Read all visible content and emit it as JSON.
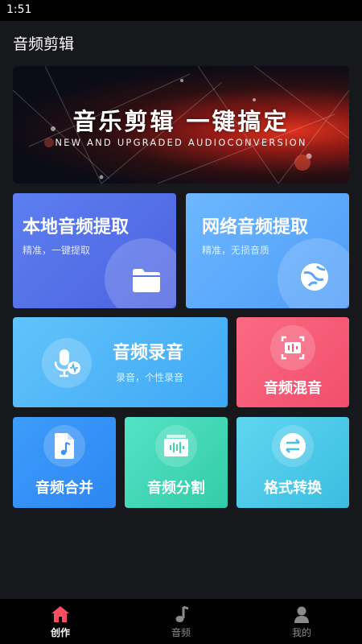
{
  "status_bar": {
    "time": "1:51"
  },
  "app": {
    "title": "音频剪辑"
  },
  "banner": {
    "title": "音乐剪辑  一键搞定",
    "subtitle": "NEW AND UPGRADED AUDIOCONVERSION"
  },
  "cards": {
    "local_extract": {
      "title": "本地音频提取",
      "subtitle": "精准，一键提取",
      "icon": "folder-icon"
    },
    "network_extract": {
      "title": "网络音频提取",
      "subtitle": "精准，无损音质",
      "icon": "globe-icon"
    },
    "record": {
      "title": "音频录音",
      "subtitle": "录音，个性录音",
      "icon": "microphone-icon"
    },
    "mix": {
      "title": "音频混音",
      "icon": "mix-icon"
    },
    "merge": {
      "title": "音频合并",
      "icon": "music-file-icon"
    },
    "split": {
      "title": "音频分割",
      "icon": "waveform-icon"
    },
    "format": {
      "title": "格式转换",
      "icon": "convert-icon"
    }
  },
  "nav": [
    {
      "label": "创作",
      "icon": "home-icon",
      "active": true
    },
    {
      "label": "音频",
      "icon": "music-note-icon",
      "active": false
    },
    {
      "label": "我的",
      "icon": "user-icon",
      "active": false
    }
  ],
  "colors": {
    "background": "#17181c",
    "nav_active": "#ff4d5e",
    "nav_inactive": "#8a8a8a"
  }
}
